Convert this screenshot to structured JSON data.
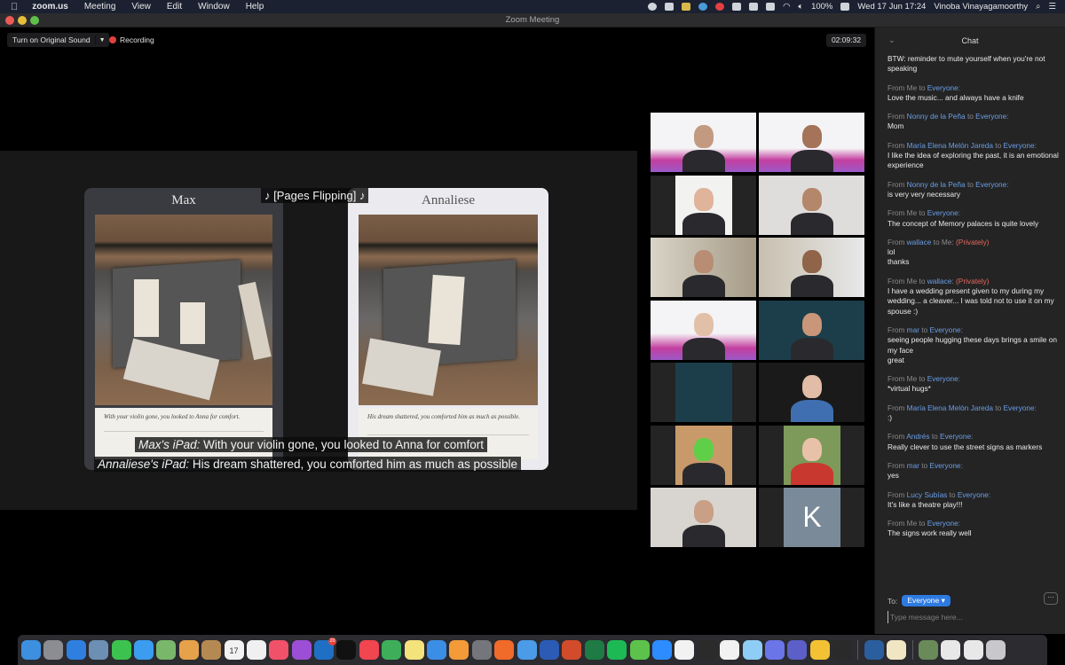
{
  "menubar": {
    "app": "zoom.us",
    "menus": [
      "Meeting",
      "View",
      "Edit",
      "Window",
      "Help"
    ],
    "battery": "100%",
    "datetime": "Wed 17 Jun  17:24",
    "user": "Vinoba  Vinayagamoorthy",
    "status_icons": [
      "screen-record-icon",
      "zoom-icon",
      "shield-icon",
      "cloud-icon",
      "record-icon",
      "binoculars-icon",
      "airplay-icon",
      "keyboard-icon",
      "wifi-icon",
      "volume-icon",
      "battery-icon",
      "spotlight-search-icon",
      "notification-center-icon"
    ]
  },
  "window": {
    "title": "Zoom Meeting"
  },
  "toolbar": {
    "original_sound": "Turn on Original Sound",
    "recording": "Recording",
    "timer": "02:09:32"
  },
  "share": {
    "sound_caption": "♪ [Pages Flipping] ♪",
    "ipads": [
      {
        "name": "Max",
        "story": "With your violin gone, you looked to Anna for comfort."
      },
      {
        "name": "Annaliese",
        "story": "His dream shattered, you comforted him as much as possible."
      }
    ],
    "captions": [
      {
        "speaker": "Max's iPad:",
        "text": " With your violin gone, you looked to Anna for comfort"
      },
      {
        "speaker": "Annaliese's iPad:",
        "text": " His dream shattered, you comforted him as much as possible"
      }
    ]
  },
  "gallery": {
    "tiles": [
      {
        "desc": "man in top hat, lmx 2020 background"
      },
      {
        "desc": "woman with headset, lmx 2020 background"
      },
      {
        "desc": "man with short hair, white wall"
      },
      {
        "desc": "man in white shirt"
      },
      {
        "desc": "man with glasses, bookshelf"
      },
      {
        "desc": "man by window"
      },
      {
        "desc": "person with headset, lmx 2020 background"
      },
      {
        "desc": "woman, I love to read sci-fi background"
      },
      {
        "desc": "I love to read sci-fi poster"
      },
      {
        "desc": "woman with headphones",
        "active": true
      },
      {
        "desc": "costumed green character"
      },
      {
        "desc": "smiling woman in red jacket"
      },
      {
        "desc": "woman with glasses"
      },
      {
        "desc": "avatar initial",
        "initial": "K"
      }
    ]
  },
  "chat": {
    "title": "Chat",
    "messages": [
      {
        "from": "",
        "to": "",
        "private": "",
        "text": "BTW: reminder to mute yourself when you're not speaking"
      },
      {
        "from": "Me",
        "to": "Everyone",
        "private": "",
        "text": "Love the music...  and always have a knife"
      },
      {
        "from": "Nonny de la Peña",
        "to": "Everyone",
        "private": "",
        "text": "Mom"
      },
      {
        "from": "María Elena Melón Jareda",
        "to": "Everyone",
        "private": "",
        "text": "I like the idea of exploring the past, it is an emotional experience"
      },
      {
        "from": "Nonny de la Peña",
        "to": "Everyone",
        "private": "",
        "text": "is very very necessary"
      },
      {
        "from": "Me",
        "to": "Everyone",
        "private": "",
        "text": "The concept of Memory palaces is quite lovely"
      },
      {
        "from": "wallace",
        "to": "Me",
        "private": "(Privately)",
        "text": "lol\nthanks"
      },
      {
        "from": "Me",
        "to": "wallace",
        "private": "(Privately)",
        "text": "I have a wedding present given to my during my wedding... a cleaver... I was told not to use it on my spouse :)"
      },
      {
        "from": "mar",
        "to": "Everyone",
        "private": "",
        "text": "seeing people hugging these days brings a smile on my face\ngreat"
      },
      {
        "from": "Me",
        "to": "Everyone",
        "private": "",
        "text": "*virtual hugs*"
      },
      {
        "from": "María Elena Melón Jareda",
        "to": "Everyone",
        "private": "",
        "text": ":)"
      },
      {
        "from": "Andrés",
        "to": "Everyone",
        "private": "",
        "text": "Really clever to use the street signs as markers"
      },
      {
        "from": "mar",
        "to": "Everyone",
        "private": "",
        "text": "yes"
      },
      {
        "from": "Lucy Subías",
        "to": "Everyone",
        "private": "",
        "text": "It's like a theatre play!!!"
      },
      {
        "from": "Me",
        "to": "Everyone",
        "private": "",
        "text": "The signs work really well"
      }
    ],
    "labels": {
      "from": "From ",
      "to": " to ",
      "colon": ":"
    },
    "to_label": "To:",
    "to_value": "Everyone",
    "more": "···",
    "input_placeholder": "Type message here..."
  },
  "dock": {
    "apps": [
      {
        "name": "finder",
        "color": "#3d8fe0"
      },
      {
        "name": "launchpad",
        "color": "#8c8c93"
      },
      {
        "name": "safari",
        "color": "#2f7fe0"
      },
      {
        "name": "preview",
        "color": "#6d8fb3"
      },
      {
        "name": "facetime",
        "color": "#3cc24f"
      },
      {
        "name": "messages",
        "color": "#3b9cf0"
      },
      {
        "name": "maps",
        "color": "#79b86a"
      },
      {
        "name": "photos",
        "color": "#e6a24a"
      },
      {
        "name": "contacts",
        "color": "#b58a52"
      },
      {
        "name": "calendar",
        "color": "#f2f2f2",
        "label": "17"
      },
      {
        "name": "reminders",
        "color": "#f0f0f0"
      },
      {
        "name": "music",
        "color": "#f15169"
      },
      {
        "name": "podcasts",
        "color": "#9c4fd6"
      },
      {
        "name": "outlook",
        "color": "#1f6fc4",
        "badge": "20"
      },
      {
        "name": "apple-tv",
        "color": "#111111"
      },
      {
        "name": "news",
        "color": "#f1454f"
      },
      {
        "name": "numbers",
        "color": "#3fae5a"
      },
      {
        "name": "notes",
        "color": "#f4e27b"
      },
      {
        "name": "keynote",
        "color": "#3b8ee5"
      },
      {
        "name": "pages",
        "color": "#f29b38"
      },
      {
        "name": "system-preferences",
        "color": "#75757c"
      },
      {
        "name": "firefox",
        "color": "#f06a2a"
      },
      {
        "name": "chrome",
        "color": "#4c9be8"
      },
      {
        "name": "word",
        "color": "#2b5bb5"
      },
      {
        "name": "powerpoint",
        "color": "#d24b2b"
      },
      {
        "name": "excel",
        "color": "#1e7b44"
      },
      {
        "name": "spotify",
        "color": "#1db954"
      },
      {
        "name": "mindnode",
        "color": "#5cc24c"
      },
      {
        "name": "zoom",
        "color": "#2d8cff"
      },
      {
        "name": "slack",
        "color": "#f2f2f2"
      },
      {
        "name": "creative-cloud",
        "color": "#2b2b2b"
      },
      {
        "name": "affinity",
        "color": "#f2f2f2"
      },
      {
        "name": "pastebot",
        "color": "#8ecdf5"
      },
      {
        "name": "discord",
        "color": "#6a75e8"
      },
      {
        "name": "teams",
        "color": "#5b5fc7"
      },
      {
        "name": "miro",
        "color": "#f2c234"
      },
      {
        "name": "globe-app",
        "color": "#2a2a2a"
      },
      {
        "sep": true
      },
      {
        "name": "quicktime",
        "color": "#2b5e9d"
      },
      {
        "name": "text-edit",
        "color": "#f1e6c4"
      },
      {
        "sep": true
      },
      {
        "name": "photo-thumbnail",
        "color": "#6a8a5a"
      },
      {
        "name": "presentation-thumbnail-1",
        "color": "#e8e8e8"
      },
      {
        "name": "presentation-thumbnail-2",
        "color": "#e8e8e8"
      },
      {
        "name": "trash",
        "color": "#c8c8cc"
      }
    ]
  }
}
